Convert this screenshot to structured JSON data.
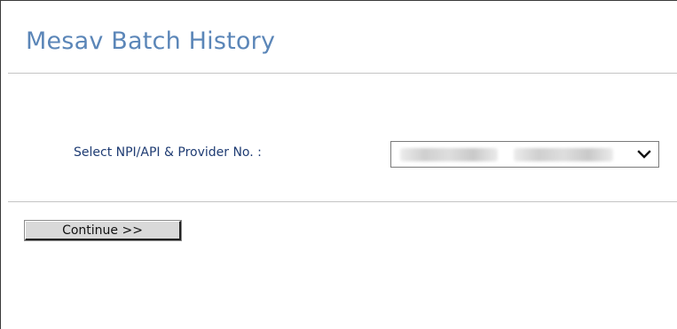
{
  "page": {
    "title": "Mesav Batch History"
  },
  "form": {
    "provider_select_label": "Select NPI/API & Provider No. :",
    "provider_select_value": "",
    "provider_select_value_obscured": true,
    "dropdown_icon": "chevron-down-icon"
  },
  "actions": {
    "continue_label": "Continue >>"
  },
  "colors": {
    "title": "#5b86b8",
    "label": "#1f3c73",
    "divider": "#c4c4c4",
    "button_face": "#d9d9d9"
  }
}
